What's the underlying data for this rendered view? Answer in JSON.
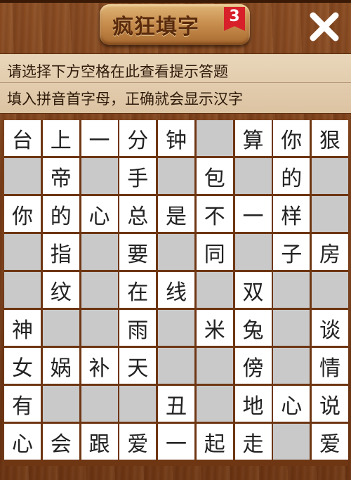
{
  "app": {
    "title": "疯狂填字",
    "level_badge": "3",
    "close_icon": "close-x-icon"
  },
  "hints": {
    "line1": "请选择下方空格在此查看提示答题",
    "line2": "填入拼音首字母，正确就会显示汉字"
  },
  "colors": {
    "wood": "#7a3e18",
    "filled_cell": "#ffffff",
    "empty_cell": "#c9c9c9",
    "badge": "#d8202a"
  },
  "grid": {
    "rows": [
      [
        "台",
        "上",
        "一",
        "分",
        "钟",
        "",
        "算",
        "你",
        "狠"
      ],
      [
        "",
        "帝",
        "",
        "手",
        "",
        "包",
        "",
        "的",
        ""
      ],
      [
        "你",
        "的",
        "心",
        "总",
        "是",
        "不",
        "一",
        "样",
        ""
      ],
      [
        "",
        "指",
        "",
        "要",
        "",
        "同",
        "",
        "子",
        "房"
      ],
      [
        "",
        "纹",
        "",
        "在",
        "线",
        "",
        "双",
        "",
        ""
      ],
      [
        "神",
        "",
        "",
        "雨",
        "",
        "米",
        "兔",
        "",
        "谈"
      ],
      [
        "女",
        "娲",
        "补",
        "天",
        "",
        "",
        "傍",
        "",
        "情"
      ],
      [
        "有",
        "",
        "",
        "",
        "丑",
        "",
        "地",
        "心",
        "说"
      ],
      [
        "心",
        "会",
        "跟",
        "爱",
        "一",
        "起",
        "走",
        "",
        "爱"
      ]
    ],
    "cell_types": [
      [
        "f",
        "f",
        "f",
        "f",
        "f",
        "e",
        "f",
        "f",
        "f"
      ],
      [
        "e",
        "f",
        "e",
        "f",
        "e",
        "f",
        "e",
        "f",
        "e"
      ],
      [
        "f",
        "f",
        "f",
        "f",
        "f",
        "f",
        "f",
        "f",
        "e"
      ],
      [
        "e",
        "f",
        "e",
        "f",
        "e",
        "f",
        "e",
        "f",
        "f"
      ],
      [
        "e",
        "f",
        "e",
        "f",
        "f",
        "e",
        "f",
        "e",
        "e"
      ],
      [
        "f",
        "e",
        "e",
        "f",
        "e",
        "f",
        "f",
        "e",
        "f"
      ],
      [
        "f",
        "f",
        "f",
        "f",
        "e",
        "e",
        "f",
        "e",
        "f"
      ],
      [
        "f",
        "e",
        "e",
        "e",
        "f",
        "e",
        "f",
        "f",
        "f"
      ],
      [
        "f",
        "f",
        "f",
        "f",
        "f",
        "f",
        "f",
        "e",
        "f"
      ]
    ]
  }
}
